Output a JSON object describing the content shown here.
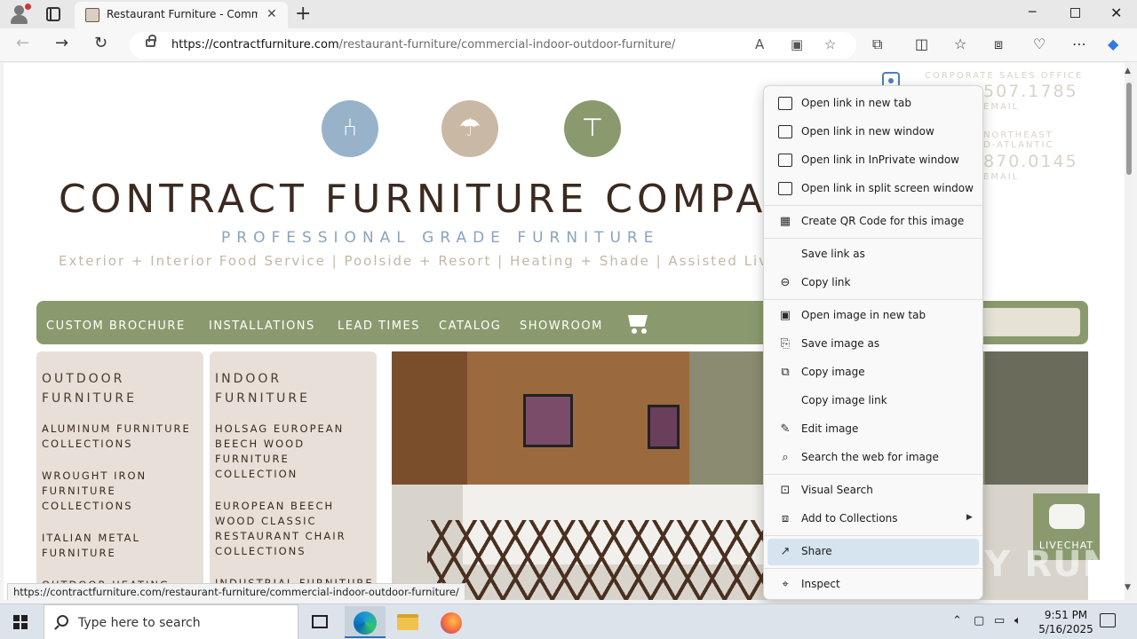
{
  "browser": {
    "tab_title": "Restaurant Furniture - Commercial Indoor Outdoor Furniture",
    "new_tab_symbol": "+",
    "tab_close_symbol": "✕",
    "url_domain": "https://contractfurniture.com",
    "url_path": "/restaurant-furniture/commercial-indoor-outdoor-furniture/",
    "status_url": "https://contractfurniture.com/restaurant-furniture/commercial-indoor-outdoor-furniture/"
  },
  "site": {
    "title": "CONTRACT FURNITURE COMPANY",
    "tagline": "PROFESSIONAL GRADE FURNITURE",
    "subline": "Exterior + Interior Food Service | Poolside + Resort | Heating + Shade | Assisted Living",
    "contact": {
      "office_label": "CORPORATE SALES OFFICE",
      "office_phone": "507.1785",
      "office_email": "EMAIL",
      "region_label_1": "NORTHEAST",
      "region_label_2": "D-ATLANTIC",
      "region_phone": "870.0145",
      "region_email": "EMAIL"
    },
    "menu": [
      "CUSTOM BROCHURE",
      "INSTALLATIONS",
      "LEAD TIMES",
      "CATALOG",
      "SHOWROOM"
    ],
    "outdoor_card": {
      "heading": "OUTDOOR FURNITURE",
      "items": [
        "ALUMINUM FURNITURE COLLECTIONS",
        "WROUGHT IRON FURNITURE COLLECTIONS",
        "ITALIAN METAL FURNITURE",
        "OUTDOOR HEATING"
      ]
    },
    "indoor_card": {
      "heading": "INDOOR FURNITURE",
      "items": [
        "HOLSAG EUROPEAN BEECH WOOD FURNITURE COLLECTION",
        "EUROPEAN BEECH WOOD CLASSIC RESTAURANT CHAIR COLLECTIONS",
        "INDUSTRIAL FURNITURE"
      ]
    },
    "livechat_label": "LIVECHAT"
  },
  "context_menu": {
    "items": [
      {
        "label": "Open link in new tab",
        "icon": "new-tab-icon"
      },
      {
        "label": "Open link in new window",
        "icon": "window-icon"
      },
      {
        "label": "Open link in InPrivate window",
        "icon": "inprivate-icon"
      },
      {
        "label": "Open link in split screen window",
        "icon": "split-screen-icon"
      },
      {
        "label": "Create QR Code for this image",
        "icon": "qr-code-icon"
      },
      {
        "label": "Save link as",
        "icon": ""
      },
      {
        "label": "Copy link",
        "icon": "link-icon"
      },
      {
        "label": "Open image in new tab",
        "icon": "image-tab-icon"
      },
      {
        "label": "Save image as",
        "icon": "save-image-icon"
      },
      {
        "label": "Copy image",
        "icon": "copy-image-icon"
      },
      {
        "label": "Copy image link",
        "icon": ""
      },
      {
        "label": "Edit image",
        "icon": "edit-image-icon"
      },
      {
        "label": "Search the web for image",
        "icon": "image-search-icon"
      },
      {
        "label": "Visual Search",
        "icon": "visual-search-icon"
      },
      {
        "label": "Add to Collections",
        "icon": "collections-icon"
      },
      {
        "label": "Share",
        "icon": "share-icon"
      },
      {
        "label": "Inspect",
        "icon": "inspect-icon"
      }
    ],
    "active_item": "Share"
  },
  "watermark": "ANY RUN",
  "taskbar": {
    "search_placeholder": "Type here to search",
    "time": "9:51 PM",
    "date": "5/16/2025"
  },
  "colors": {
    "sage": "#8a9a6e",
    "beige_card": "#e8e0d8",
    "title_brown": "#3a2a1f",
    "tagline_blue": "#8aa3bd",
    "menu_highlight": "#d6e4f0"
  }
}
